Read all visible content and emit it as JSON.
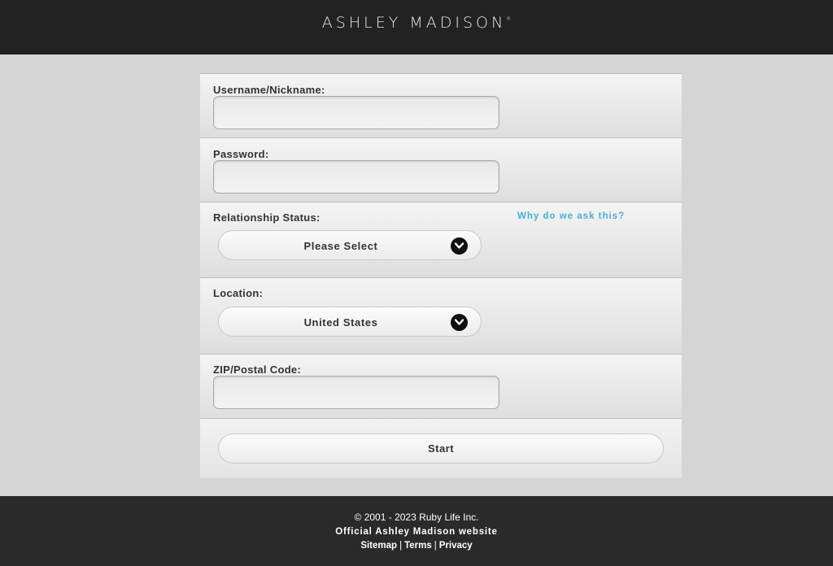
{
  "header": {
    "logo_text": "ASHLEY MADISON",
    "logo_mark": "®"
  },
  "form": {
    "username": {
      "label": "Username/Nickname:",
      "value": "",
      "placeholder": ""
    },
    "password": {
      "label": "Password:",
      "value": "",
      "placeholder": ""
    },
    "relationship": {
      "label": "Relationship Status:",
      "selected": "Please Select",
      "why_link": "Why do we ask this?"
    },
    "location": {
      "label": "Location:",
      "selected": "United States"
    },
    "zip": {
      "label": "ZIP/Postal Code:",
      "value": "",
      "placeholder": ""
    },
    "start_label": "Start"
  },
  "footer": {
    "copyright": "© 2001 - 2023 Ruby Life Inc.",
    "official": "Official Ashley Madison website",
    "links": [
      "Sitemap",
      "Terms",
      "Privacy"
    ],
    "separator": "|"
  },
  "colors": {
    "header_bg": "#222222",
    "page_bg": "#d5d5d5",
    "link_accent": "#4aaed3",
    "footer_bg": "#2a2a2a"
  },
  "icons": {
    "select_arrow": "chevron-down-icon"
  }
}
